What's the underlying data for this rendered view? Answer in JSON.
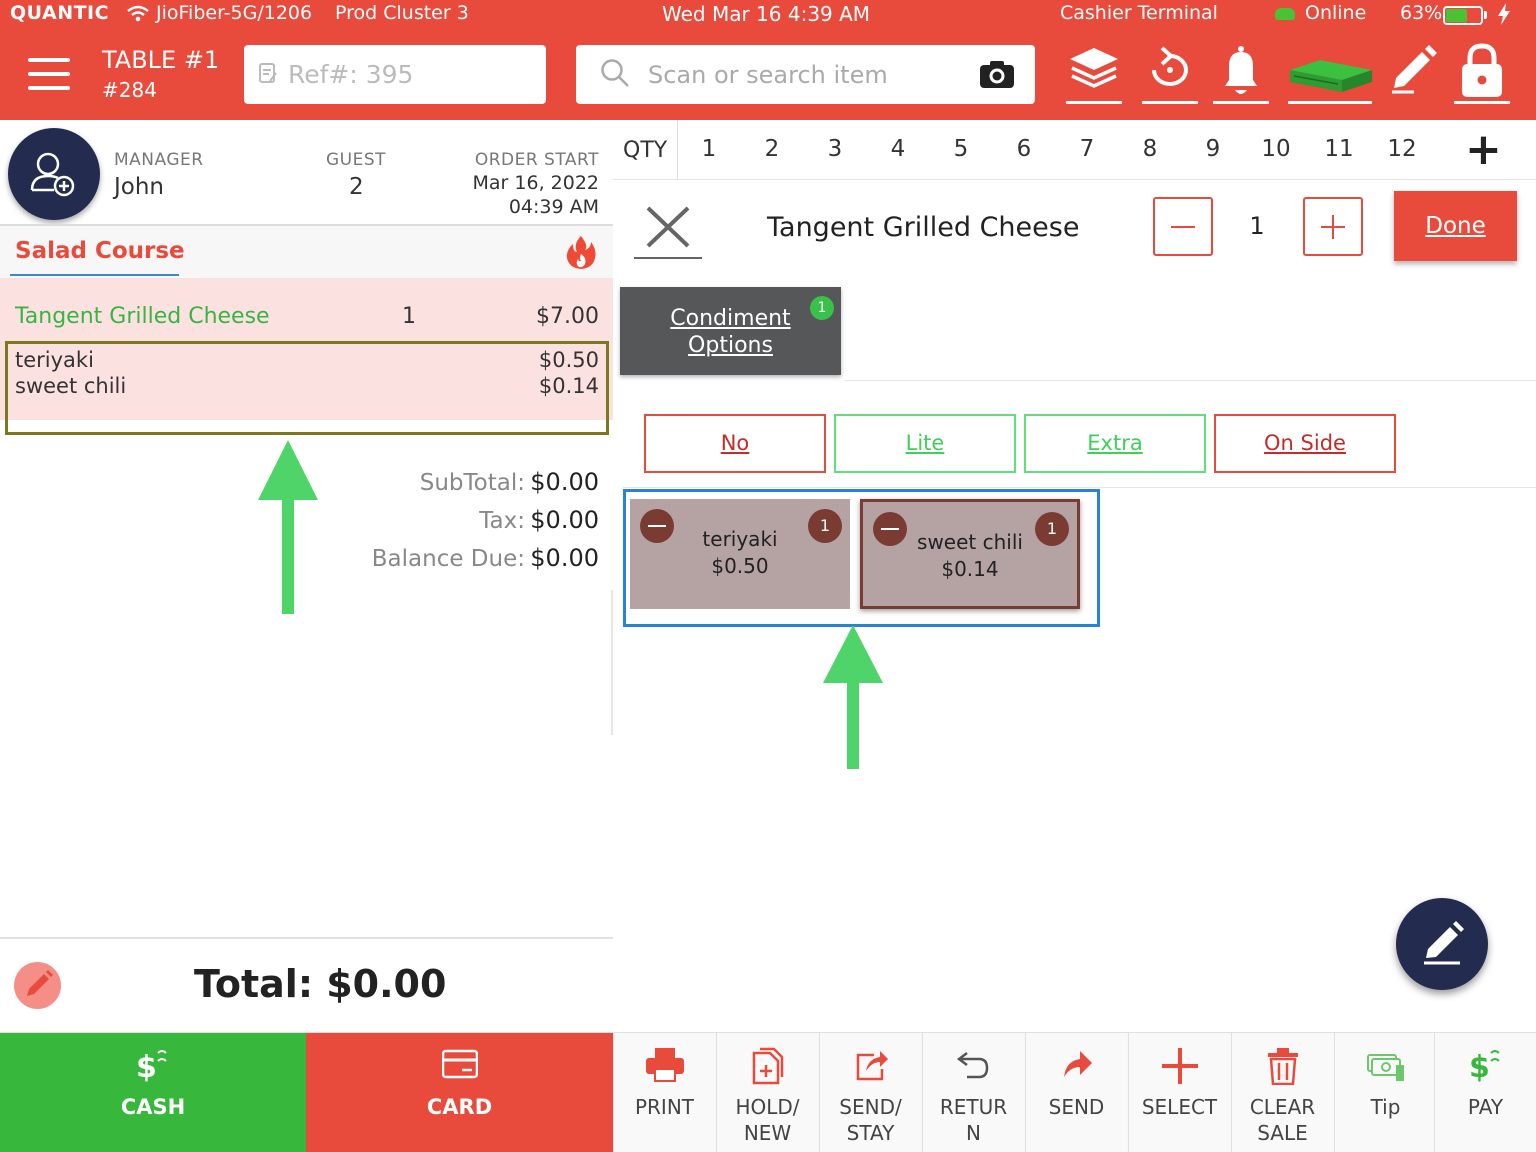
{
  "status": {
    "logo": "QUANTIC",
    "network": "JioFiber-5G/1206",
    "cluster": "Prod Cluster 3",
    "datetime": "Wed Mar 16 4:39 AM",
    "terminal": "Cashier Terminal",
    "online": "Online",
    "battery": "63%",
    "battery_level": 0.63
  },
  "header": {
    "table_name": "TABLE #1",
    "table_number": "#284",
    "ref_placeholder": "Ref#: 395",
    "search_placeholder": "Scan or search item",
    "tools": [
      "layers-icon",
      "refresh-icon",
      "bell-icon",
      "cash-stack-icon",
      "pencil-icon",
      "lock-icon"
    ]
  },
  "order": {
    "manager_label": "MANAGER",
    "manager_name": "John",
    "guest_label": "GUEST",
    "guest_count": "2",
    "order_start_label": "ORDER START",
    "order_start_date": "Mar 16, 2022",
    "order_start_time": "04:39 AM",
    "course": "Salad Course",
    "items": [
      {
        "name": "Tangent Grilled Cheese",
        "qty": "1",
        "price": "$7.00",
        "modifiers": [
          {
            "name": "teriyaki",
            "price": "$0.50"
          },
          {
            "name": "sweet chili",
            "price": "$0.14"
          }
        ]
      }
    ],
    "subtotal_label": "SubTotal:",
    "subtotal": "$0.00",
    "tax_label": "Tax:",
    "tax": "$0.00",
    "balance_label": "Balance Due:",
    "balance": "$0.00",
    "total": "Total: $0.00"
  },
  "qty_bar": {
    "label": "QTY",
    "numbers": [
      "1",
      "2",
      "3",
      "4",
      "5",
      "6",
      "7",
      "8",
      "9",
      "10",
      "11",
      "12"
    ]
  },
  "editor": {
    "title": "Tangent Grilled Cheese",
    "quantity": "1",
    "done_label": "Done",
    "condiment_tab_line1": "Condiment",
    "condiment_tab_line2": "Options",
    "condiment_count": "1",
    "options": [
      "No",
      "Lite",
      "Extra",
      "On Side"
    ],
    "selected_modifiers": [
      {
        "name": "teriyaki",
        "price": "$0.50",
        "count": "1"
      },
      {
        "name": "sweet chili",
        "price": "$0.14",
        "count": "1"
      }
    ]
  },
  "bottom": {
    "cash_label": "CASH",
    "card_label": "CARD",
    "actions": [
      {
        "label": "PRINT",
        "icon": "printer-icon"
      },
      {
        "label": "HOLD/\nNEW",
        "icon": "hold-document-icon"
      },
      {
        "label": "SEND/\nSTAY",
        "icon": "share-icon"
      },
      {
        "label": "RETUR\nN",
        "icon": "undo-icon"
      },
      {
        "label": "SEND",
        "icon": "send-arrow-icon"
      },
      {
        "label": "SELECT",
        "icon": "plus-icon"
      },
      {
        "label": "CLEAR\nSALE",
        "icon": "trash-icon"
      },
      {
        "label": "Tip",
        "icon": "money-icon"
      },
      {
        "label": "PAY",
        "icon": "dollar-icon"
      }
    ]
  },
  "colors": {
    "brand_red": "#e84a3c",
    "cash_green": "#37b83c",
    "navy": "#232c4f",
    "item_green": "#38b443",
    "highlight_blue": "#2a82d4",
    "highlight_olive": "#7c7820",
    "arrow_green": "#4fd46a"
  }
}
